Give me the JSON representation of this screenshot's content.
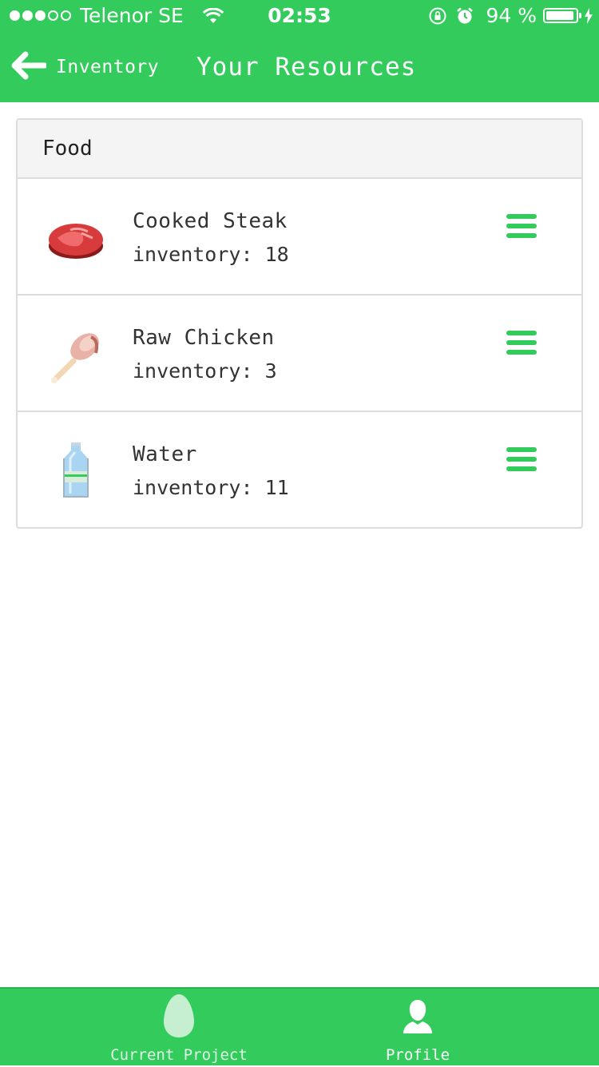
{
  "status_bar": {
    "carrier": "Telenor SE",
    "time": "02:53",
    "battery_percent": "94 %",
    "battery_level": 0.94,
    "signal_bars_filled": 3,
    "signal_bars_total": 5
  },
  "nav": {
    "back_label": "Inventory",
    "title": "Your Resources"
  },
  "section": {
    "header": "Food"
  },
  "items": [
    {
      "name": "Cooked Steak",
      "inventory": "inventory: 18",
      "icon": "steak-icon"
    },
    {
      "name": "Raw Chicken",
      "inventory": "inventory: 3",
      "icon": "chicken-leg-icon"
    },
    {
      "name": "Water",
      "inventory": "inventory: 11",
      "icon": "water-bottle-icon"
    }
  ],
  "tabs": [
    {
      "label": "Current Project",
      "icon": "egg-icon"
    },
    {
      "label": "Profile",
      "icon": "person-icon"
    }
  ],
  "colors": {
    "brand_green": "#33cc5c",
    "menu_green": "#33cc5c",
    "divider": "#dcdcdc",
    "header_bg": "#f4f4f4"
  }
}
